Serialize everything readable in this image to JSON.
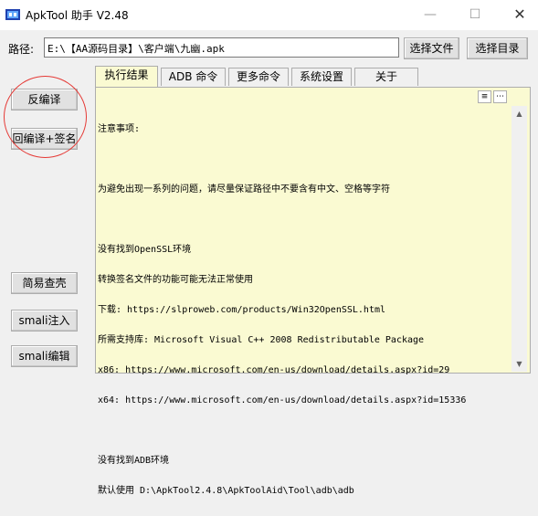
{
  "window": {
    "title": "ApkTool 助手 V2.48",
    "minimize": "—",
    "maximize": "☐",
    "close": "✕"
  },
  "path": {
    "label": "路径:",
    "value": "E:\\【AA源码目录】\\客户端\\九幽.apk",
    "select_file": "选择文件",
    "select_dir": "选择目录"
  },
  "tabs": [
    {
      "label": "执行结果",
      "active": true
    },
    {
      "label": "ADB 命令",
      "active": false
    },
    {
      "label": "更多命令",
      "active": false
    },
    {
      "label": "系统设置",
      "active": false
    },
    {
      "label": "关于",
      "active": false
    }
  ],
  "sidebar": {
    "decompile": "反编译",
    "recompile_sign": "回编译+签名",
    "shell_check": "简易查壳",
    "smali_inject": "smali注入",
    "smali_edit": "smali编辑"
  },
  "panel": {
    "lines": [
      "注意事项:",
      "",
      "为避免出现一系列的问题，请尽量保证路径中不要含有中文、空格等字符",
      "",
      "没有找到OpenSSL环境",
      "转换签名文件的功能可能无法正常使用",
      "下载: https://slproweb.com/products/Win32OpenSSL.html",
      "所需支持库: Microsoft Visual C++ 2008 Redistributable Package",
      "x86: https://www.microsoft.com/en-us/download/details.aspx?id=29",
      "x64: https://www.microsoft.com/en-us/download/details.aspx?id=15336",
      "",
      "没有找到ADB环境",
      "默认使用 D:\\ApkTool2.4.8\\ApkToolAid\\Tool\\adb\\adb"
    ],
    "list_icon": "≡",
    "more_icon": "⋯"
  },
  "scrollbar": {
    "up": "▲",
    "down": "▼"
  },
  "colors": {
    "panel_bg": "#fafad2",
    "annotation_circle": "#e53935"
  }
}
